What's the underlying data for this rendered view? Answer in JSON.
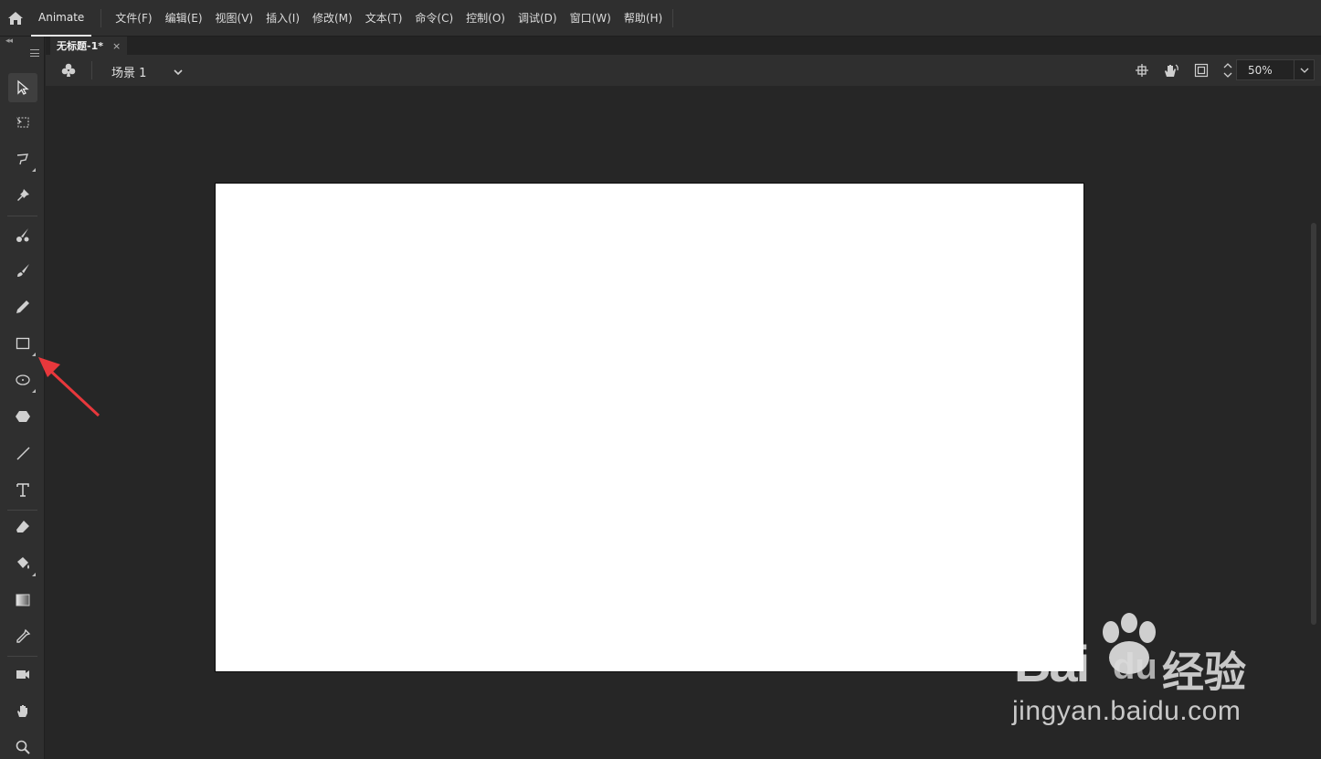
{
  "menubar": {
    "app_name": "Animate",
    "items": [
      "文件(F)",
      "编辑(E)",
      "视图(V)",
      "插入(I)",
      "修改(M)",
      "文本(T)",
      "命令(C)",
      "控制(O)",
      "调试(D)",
      "窗口(W)",
      "帮助(H)"
    ]
  },
  "document": {
    "tab_title": "无标题-1*",
    "tab_close": "×"
  },
  "scene": {
    "name": "场景 1",
    "zoom": "50%"
  },
  "tools": [
    {
      "name": "selection-tool",
      "active": true
    },
    {
      "name": "free-transform-tool"
    },
    {
      "name": "lasso-tool"
    },
    {
      "name": "asset-warp-tool"
    },
    {
      "name": "fluid-brush-tool"
    },
    {
      "name": "classic-brush-tool"
    },
    {
      "name": "pencil-tool"
    },
    {
      "name": "rectangle-tool"
    },
    {
      "name": "oval-tool"
    },
    {
      "name": "polystar-tool"
    },
    {
      "name": "line-tool"
    },
    {
      "name": "text-tool"
    },
    {
      "name": "eraser-tool"
    },
    {
      "name": "paint-bucket-tool"
    },
    {
      "name": "gradient-tool"
    },
    {
      "name": "eyedropper-tool"
    },
    {
      "name": "camera-tool"
    },
    {
      "name": "hand-tool"
    },
    {
      "name": "zoom-tool"
    }
  ],
  "colors": {
    "accent_arrow": "#e8383c",
    "stage": "#ffffff",
    "workspace": "#262626"
  },
  "watermark": {
    "brand_bai": "Bai",
    "brand_du": "du",
    "brand_cn": "经验",
    "url": "jingyan.baidu.com"
  }
}
